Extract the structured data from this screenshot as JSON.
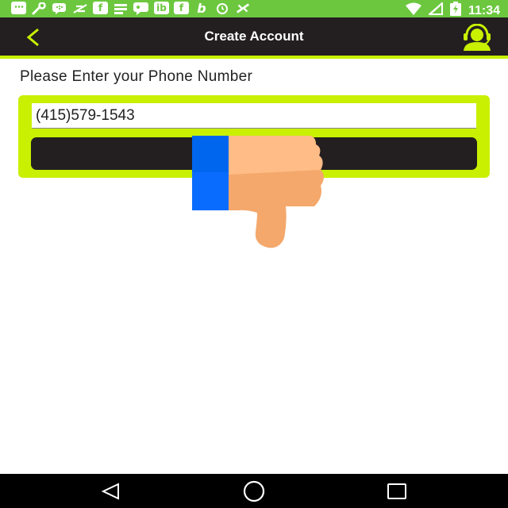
{
  "status_bar": {
    "time": "11:34",
    "icons": [
      "message-icon",
      "wrench-icon",
      "bbm-icon",
      "app-icon",
      "facebook-icon",
      "equalizer-icon",
      "chat-icon",
      "ib-icon",
      "facebook-icon",
      "b-icon",
      "alarm-icon",
      "no-sim-icon",
      "wifi-icon",
      "signal-icon",
      "battery-charging-icon"
    ],
    "ib_text": "ib",
    "f_text": "f",
    "b_text": "b"
  },
  "app_bar": {
    "title": "Create Account",
    "back_icon": "chevron-left-icon",
    "support_icon": "support-agent-icon"
  },
  "form": {
    "prompt": "Please Enter your Phone Number",
    "phone_value": "(415)579-1543",
    "submit_label": ""
  },
  "colors": {
    "status_bar": "#6cc73f",
    "app_bar": "#231f20",
    "accent": "#c8f000",
    "button": "#231f20"
  },
  "nav_bar": {
    "buttons": [
      "back-triangle-icon",
      "home-circle-icon",
      "recents-square-icon"
    ]
  }
}
